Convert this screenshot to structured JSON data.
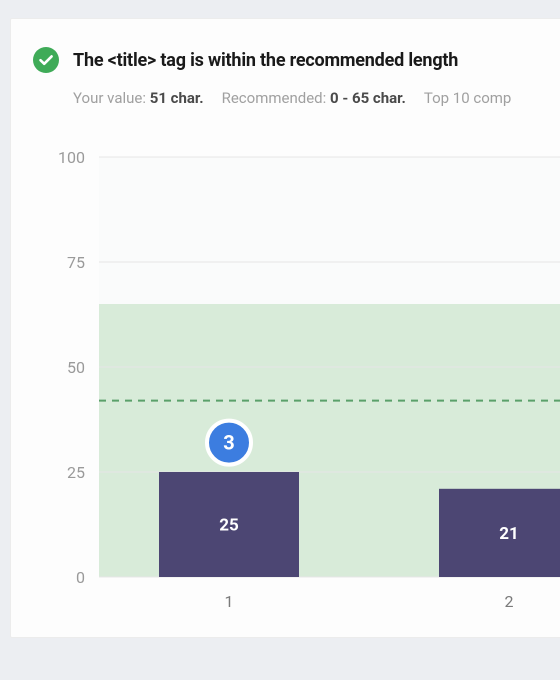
{
  "header": {
    "icon": "check-circle-icon",
    "title": "The <title> tag is within the recommended length"
  },
  "stats": {
    "your_value_label": "Your value:",
    "your_value": "51 char.",
    "recommended_label": "Recommended:",
    "recommended_value": "0 - 65 char.",
    "top10_label": "Top 10 comp"
  },
  "chart_data": {
    "type": "bar",
    "categories": [
      "1",
      "2"
    ],
    "values": [
      25,
      21
    ],
    "ylim": [
      0,
      100
    ],
    "yticks": [
      0,
      25,
      50,
      75,
      100
    ],
    "recommended_band": [
      0,
      65
    ],
    "reference_line": 42,
    "marker": {
      "category_index": 0,
      "label": "3",
      "y": 32
    },
    "colors": {
      "bar": "#4c4673",
      "band": "#d8ebd9",
      "dash": "#5aa06a",
      "marker": "#3c7de0"
    }
  }
}
